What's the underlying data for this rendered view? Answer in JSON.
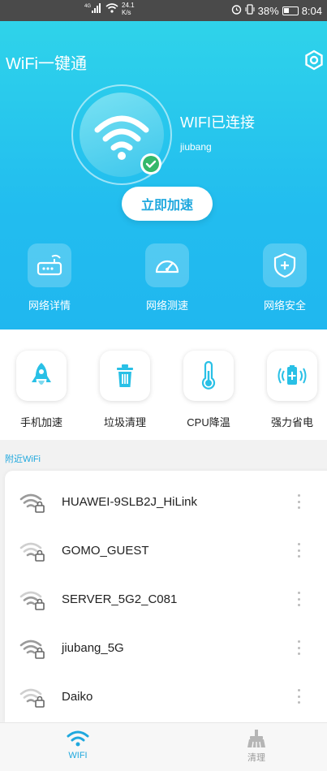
{
  "status_bar": {
    "signal_label": "4G",
    "speed_value": "24.1",
    "speed_unit": "K/s",
    "battery": "38%",
    "time": "8:04"
  },
  "header": {
    "title": "WiFi一键通"
  },
  "connection": {
    "status": "WIFI已连接",
    "ssid": "jiubang",
    "speedup_label": "立即加速"
  },
  "tools": [
    {
      "label": "网络详情",
      "icon": "router-icon"
    },
    {
      "label": "网络测速",
      "icon": "speedometer-icon"
    },
    {
      "label": "网络安全",
      "icon": "shield-icon"
    }
  ],
  "features": [
    {
      "label": "手机加速",
      "icon": "rocket-icon"
    },
    {
      "label": "垃圾清理",
      "icon": "trash-icon"
    },
    {
      "label": "CPU降温",
      "icon": "thermometer-icon"
    },
    {
      "label": "强力省电",
      "icon": "battery-icon"
    }
  ],
  "nearby": {
    "section_label": "附近WiFi",
    "networks": [
      {
        "ssid": "HUAWEI-9SLB2J_HiLink",
        "locked": true
      },
      {
        "ssid": "GOMO_GUEST",
        "locked": true
      },
      {
        "ssid": "SERVER_5G2_C081",
        "locked": true
      },
      {
        "ssid": "jiubang_5G",
        "locked": true
      },
      {
        "ssid": "Daiko",
        "locked": true
      }
    ]
  },
  "tabs": [
    {
      "label": "WIFI",
      "active": true
    },
    {
      "label": "清理",
      "active": false
    }
  ],
  "colors": {
    "accent": "#1fa8de",
    "hero_top": "#2fd3ea",
    "hero_bottom": "#20b7ef",
    "check": "#34b86a"
  }
}
